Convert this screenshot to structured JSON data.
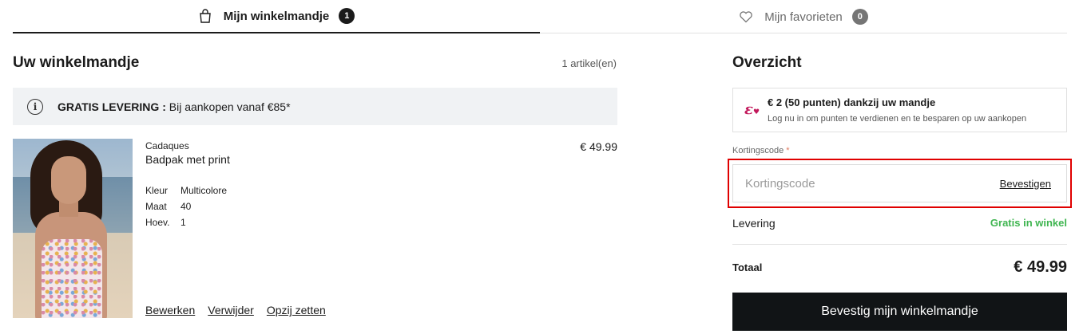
{
  "tabs": {
    "cart": {
      "label": "Mijn winkelmandje",
      "badge": "1",
      "icon": "bag-icon"
    },
    "favorites": {
      "label": "Mijn favorieten",
      "badge": "0",
      "icon": "heart-icon"
    }
  },
  "cart": {
    "title": "Uw winkelmandje",
    "count": "1 artikel(en)",
    "banner": {
      "bold": "GRATIS LEVERING :",
      "text": " Bij aankopen vanaf €85*",
      "icon": "info-icon"
    },
    "item": {
      "brand": "Cadaques",
      "name": "Badpak met print",
      "price": "€ 49.99",
      "attributes": [
        {
          "key": "Kleur",
          "value": "Multicolore"
        },
        {
          "key": "Maat",
          "value": "40"
        },
        {
          "key": "Hoev.",
          "value": "1"
        }
      ],
      "actions": {
        "edit": "Bewerken",
        "remove": "Verwijder",
        "save": "Opzij zetten"
      }
    }
  },
  "summary": {
    "title": "Overzicht",
    "points": {
      "icon": "loyalty-icon",
      "title": "€ 2 (50 punten) dankzij uw mandje",
      "subtitle": "Log nu in om punten te verdienen en te besparen op uw aankopen"
    },
    "coupon": {
      "label": "Kortingscode",
      "required_mark": "*",
      "placeholder": "Kortingscode",
      "value": "",
      "confirm": "Bevestigen"
    },
    "delivery": {
      "label": "Levering",
      "value": "Gratis in winkel"
    },
    "total": {
      "label": "Totaal",
      "value": "€ 49.99"
    },
    "confirm_button": "Bevestig mijn winkelmandje"
  },
  "colors": {
    "accent_green": "#3fb550",
    "button_dark": "#111416",
    "highlight_red": "#e00000",
    "loyalty_pink": "#c2185b"
  }
}
